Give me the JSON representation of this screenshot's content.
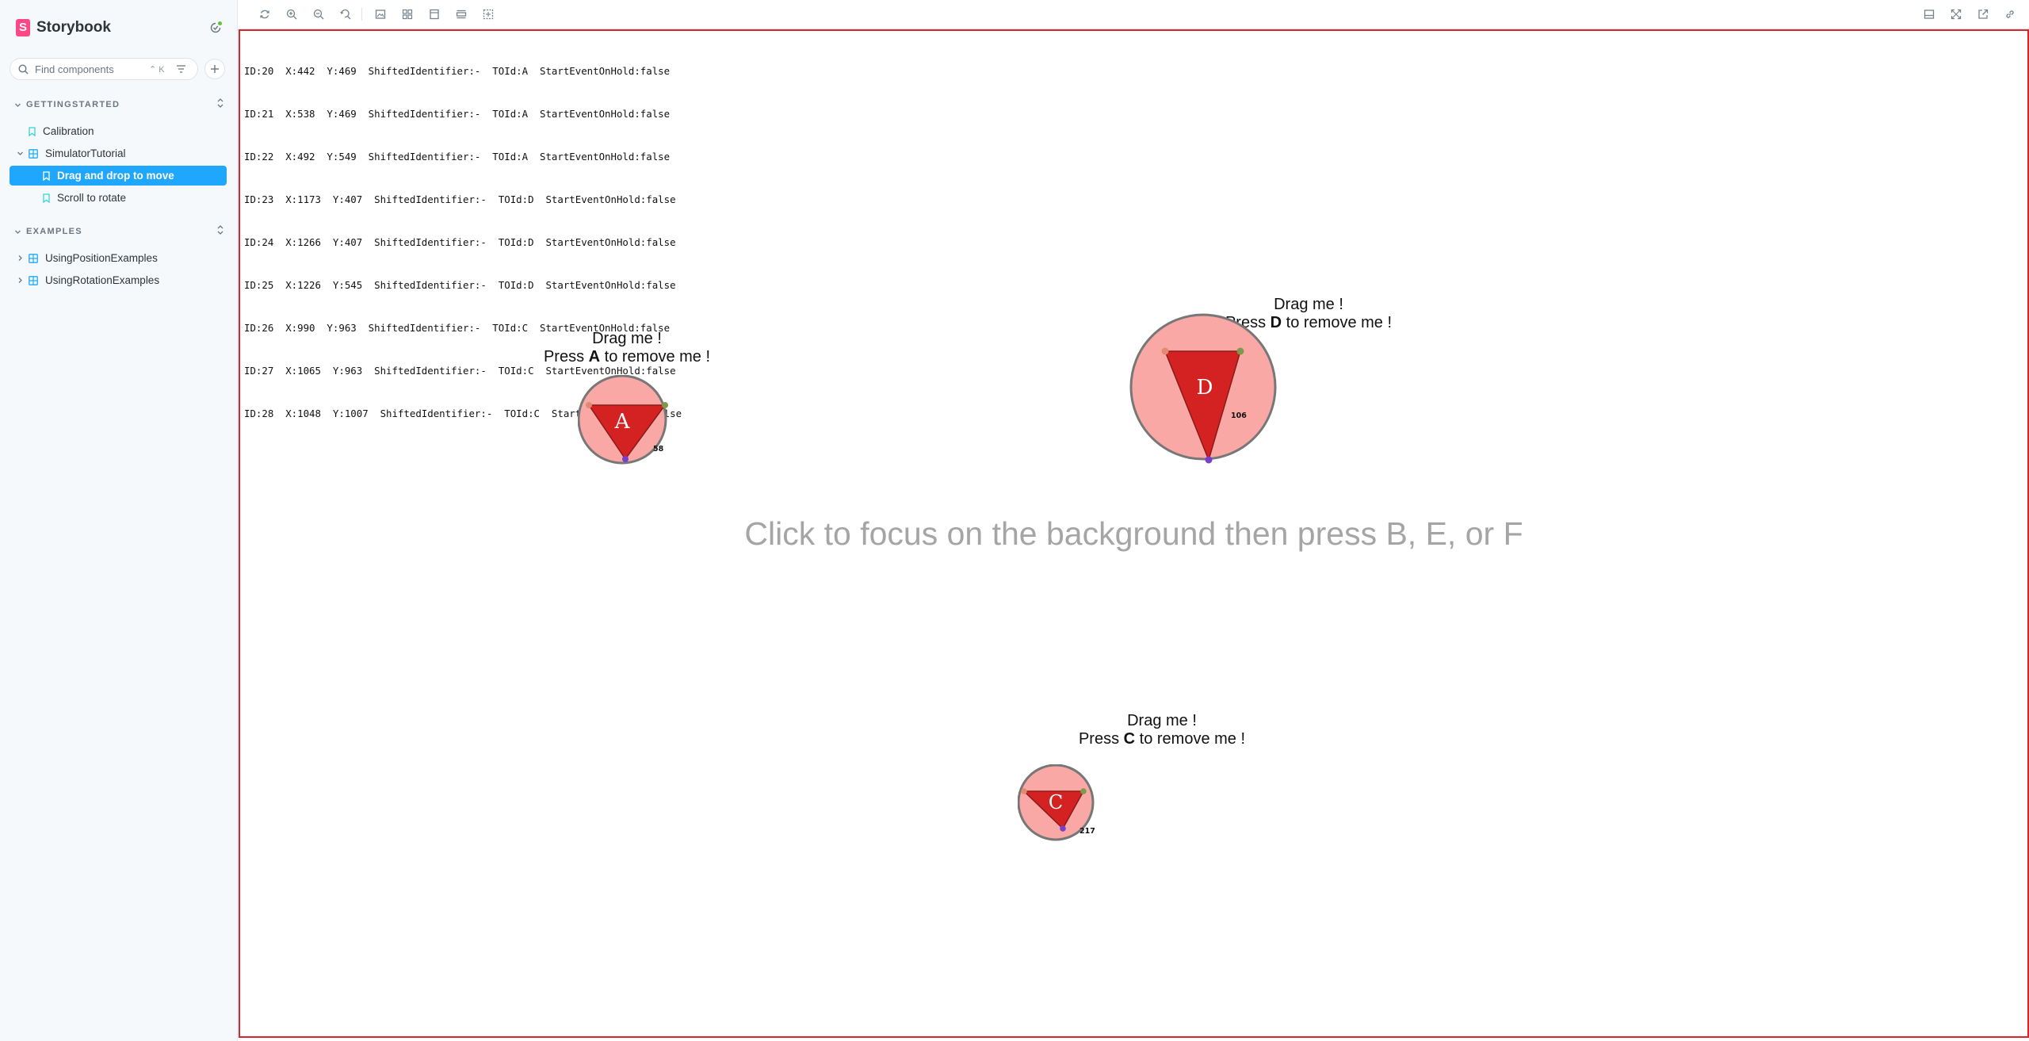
{
  "app": {
    "name": "Storybook",
    "logo_letter": "S"
  },
  "search": {
    "placeholder": "Find components",
    "shortcut": "⌃ K"
  },
  "sidebar": {
    "sections": [
      {
        "title": "GETTINGSTARTED",
        "items": [
          {
            "label": "Calibration",
            "type": "story"
          },
          {
            "label": "SimulatorTutorial",
            "type": "component",
            "expanded": true,
            "children": [
              {
                "label": "Drag and drop to move",
                "type": "story",
                "selected": true
              },
              {
                "label": "Scroll to rotate",
                "type": "story"
              }
            ]
          }
        ]
      },
      {
        "title": "EXAMPLES",
        "items": [
          {
            "label": "UsingPositionExamples",
            "type": "component"
          },
          {
            "label": "UsingRotationExamples",
            "type": "component"
          }
        ]
      }
    ]
  },
  "toolbar": {
    "left": [
      "reload-icon",
      "zoom-in-icon",
      "zoom-out-icon",
      "zoom-reset-icon",
      "background-icon",
      "grid-icon",
      "viewport-icon",
      "measure-icon",
      "outline-icon"
    ],
    "right": [
      "panel-toggle-icon",
      "fullscreen-icon",
      "open-new-tab-icon",
      "copy-link-icon"
    ]
  },
  "canvas": {
    "log_lines": [
      "ID:20  X:442  Y:469  ShiftedIdentifier:-  TOId:A  StartEventOnHold:false",
      "ID:21  X:538  Y:469  ShiftedIdentifier:-  TOId:A  StartEventOnHold:false",
      "ID:22  X:492  Y:549  ShiftedIdentifier:-  TOId:A  StartEventOnHold:false",
      "ID:23  X:1173  Y:407  ShiftedIdentifier:-  TOId:D  StartEventOnHold:false",
      "ID:24  X:1266  Y:407  ShiftedIdentifier:-  TOId:D  StartEventOnHold:false",
      "ID:25  X:1226  Y:545  ShiftedIdentifier:-  TOId:D  StartEventOnHold:false",
      "ID:26  X:990  Y:963  ShiftedIdentifier:-  TOId:C  StartEventOnHold:false",
      "ID:27  X:1065  Y:963  ShiftedIdentifier:-  TOId:C  StartEventOnHold:false",
      "ID:28  X:1048  Y:1007  ShiftedIdentifier:-  TOId:C  StartEventOnHold:false"
    ],
    "background_hint": "Click to focus on the background then press B, E, or F",
    "objects": [
      {
        "letter": "A",
        "line1": "Drag me !",
        "line2_prefix": "Press ",
        "line2_key": "A",
        "line2_suffix": " to remove me !",
        "angle_label": "58"
      },
      {
        "letter": "D",
        "line1": "Drag me !",
        "line2_prefix": "Press ",
        "line2_key": "D",
        "line2_suffix": " to remove me !",
        "angle_label": "106"
      },
      {
        "letter": "C",
        "line1": "Drag me !",
        "line2_prefix": "Press ",
        "line2_key": "C",
        "line2_suffix": " to remove me !",
        "angle_label": "217"
      }
    ]
  },
  "colors": {
    "accent": "#1ea7fd",
    "brand": "#ff4785",
    "frame_border": "#d6262c",
    "circle_fill": "#f9a8a6",
    "triangle_fill": "#d42222",
    "hint_text": "#a5a5a5"
  }
}
